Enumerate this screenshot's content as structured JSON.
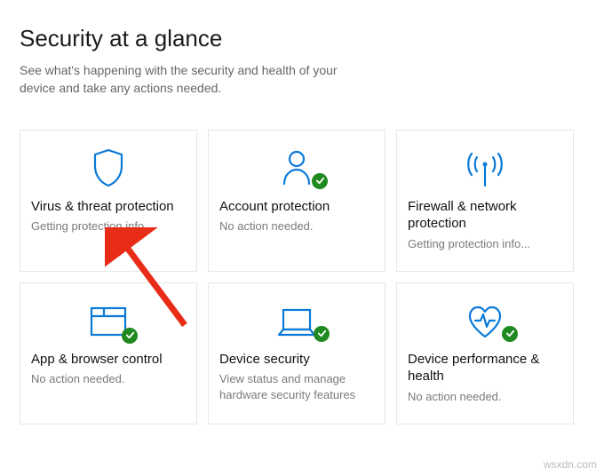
{
  "header": {
    "title": "Security at a glance",
    "subtitle": "See what's happening with the security and health of your device and take any actions needed."
  },
  "tiles": {
    "virus": {
      "title": "Virus & threat protection",
      "status": "Getting protection info..."
    },
    "account": {
      "title": "Account protection",
      "status": "No action needed."
    },
    "firewall": {
      "title": "Firewall & network protection",
      "status": "Getting protection info..."
    },
    "appbrowser": {
      "title": "App & browser control",
      "status": "No action needed."
    },
    "device": {
      "title": "Device security",
      "status": "View status and manage hardware security features"
    },
    "performance": {
      "title": "Device performance & health",
      "status": "No action needed."
    }
  },
  "colors": {
    "iconBlue": "#0a79d8",
    "badgeGreen": "#1f8a1f",
    "arrowRed": "#e82c18"
  },
  "watermark": "wsxdn.com"
}
